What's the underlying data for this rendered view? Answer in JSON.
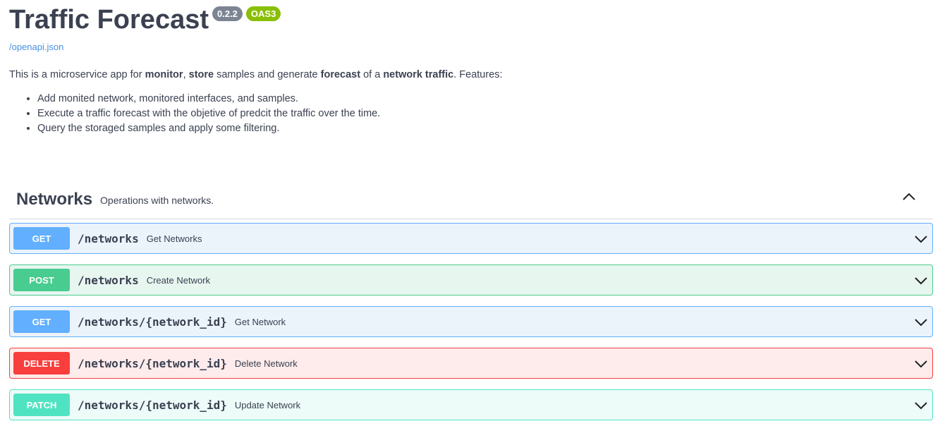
{
  "header": {
    "title": "Traffic Forecast",
    "version": "0.2.2",
    "oas": "OAS3",
    "spec_link": "/openapi.json"
  },
  "description": {
    "parts": [
      "This is a microservice app for ",
      "monitor",
      ", ",
      "store",
      " samples and generate ",
      "forecast",
      " of a ",
      "network traffic",
      ". Features:"
    ],
    "features": [
      "Add monited network, monitored interfaces, and samples.",
      "Execute a traffic forecast with the objetive of predcit the traffic over the time.",
      "Query the storaged samples and apply some filtering."
    ]
  },
  "tag": {
    "name": "Networks",
    "description": "Operations with networks."
  },
  "operations": [
    {
      "method": "GET",
      "path": "/networks",
      "summary": "Get Networks"
    },
    {
      "method": "POST",
      "path": "/networks",
      "summary": "Create Network"
    },
    {
      "method": "GET",
      "path": "/networks/{network_id}",
      "summary": "Get Network"
    },
    {
      "method": "DELETE",
      "path": "/networks/{network_id}",
      "summary": "Delete Network"
    },
    {
      "method": "PATCH",
      "path": "/networks/{network_id}",
      "summary": "Update Network"
    }
  ],
  "colors": {
    "get": "#61affe",
    "post": "#49cc90",
    "delete": "#f93e3e",
    "patch": "#50e3c2",
    "version_badge": "#7d8492",
    "oas_badge": "#89bf04"
  }
}
